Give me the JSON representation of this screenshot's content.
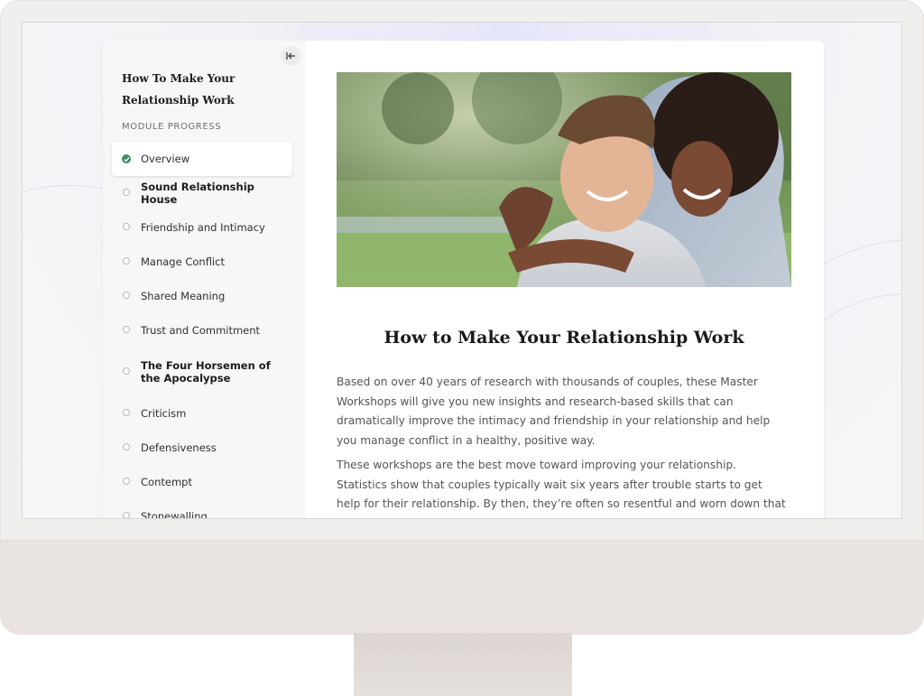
{
  "sidebar": {
    "collapse_icon": "collapse-left-icon",
    "course_title": "How To Make Your Relationship Work",
    "progress_label": "MODULE PROGRESS",
    "items": [
      {
        "label": "Overview",
        "state": "completed",
        "bold": false
      },
      {
        "label": "Sound Relationship House",
        "state": "pending",
        "bold": true
      },
      {
        "label": "Friendship and Intimacy",
        "state": "pending",
        "bold": false
      },
      {
        "label": "Manage Conflict",
        "state": "pending",
        "bold": false
      },
      {
        "label": "Shared Meaning",
        "state": "pending",
        "bold": false
      },
      {
        "label": "Trust and Commitment",
        "state": "pending",
        "bold": false
      },
      {
        "label": "The Four Horsemen of the Apocalypse",
        "state": "pending",
        "bold": true
      },
      {
        "label": "Criticism",
        "state": "pending",
        "bold": false
      },
      {
        "label": "Defensiveness",
        "state": "pending",
        "bold": false
      },
      {
        "label": "Contempt",
        "state": "pending",
        "bold": false
      },
      {
        "label": "Stonewalling",
        "state": "pending",
        "bold": false
      }
    ]
  },
  "main": {
    "hero_image": "smiling-couple-photo",
    "title": "How to Make Your Relationship Work",
    "paragraphs": [
      "Based on over 40 years of research with thousands of couples, these Master Workshops will give you new insights and research-based skills that can dramatically improve the intimacy and friendship in your relationship and help you manage conflict in a healthy, positive way.",
      "These workshops are the best move toward improving your relationship. Statistics show that couples typically wait six years after trouble starts to get help for their relationship. By then, they’re often so resentful and worn down that getting back on"
    ]
  },
  "colors": {
    "completed": "#3f8e62",
    "sidebar_bg": "#f7f7f7",
    "monitor_body": "#f1efee",
    "monitor_chin": "#e9e4e1"
  }
}
